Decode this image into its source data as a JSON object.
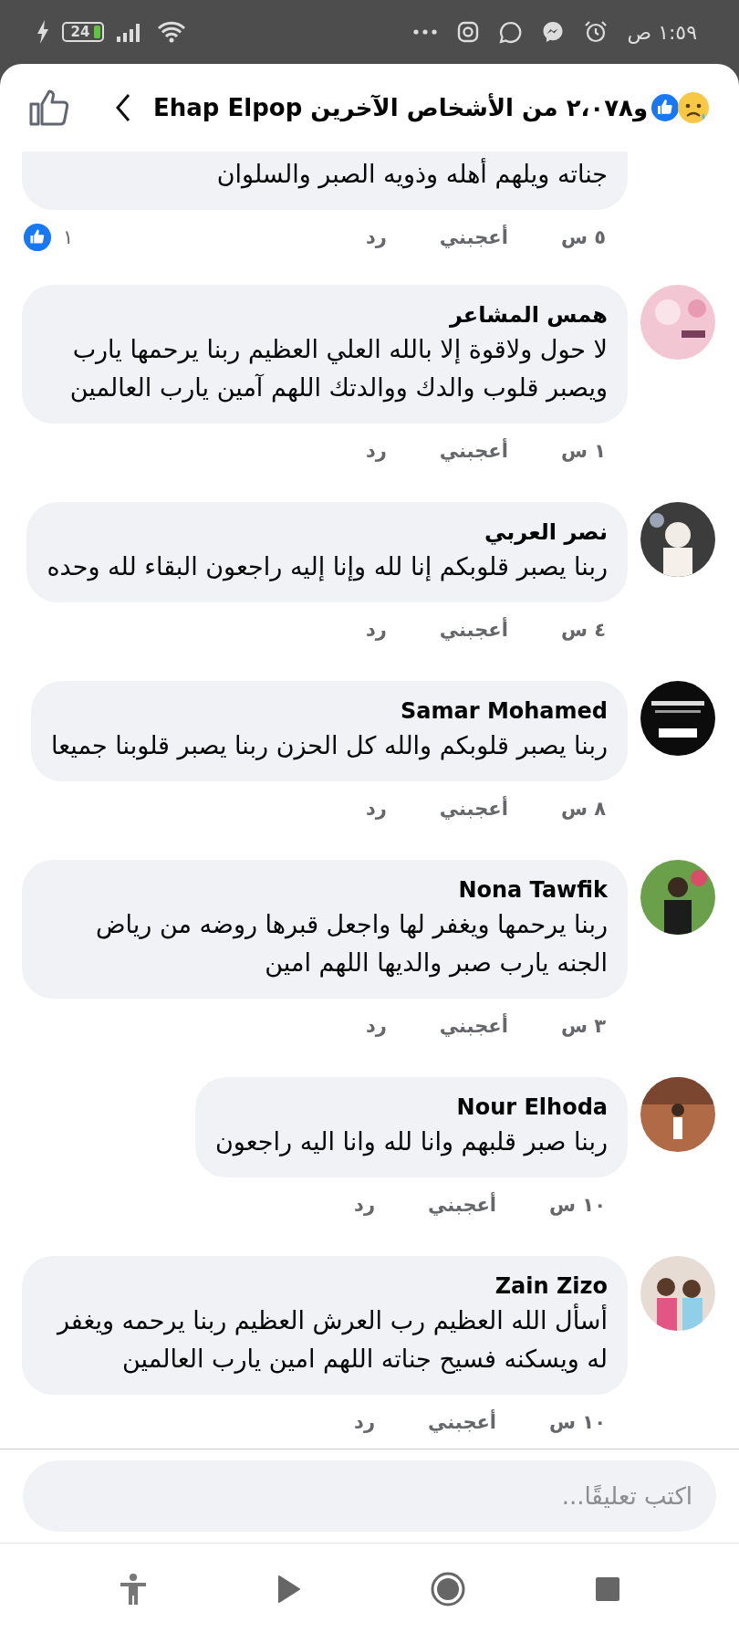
{
  "status_bar": {
    "time": "١:٥٩ ص",
    "battery": "24"
  },
  "header": {
    "title": "و٢،٠٧٨ من الأشخاص الآخرين Ehap Elpop"
  },
  "comments": [
    {
      "text": "جناته ويلهم أهله وذويه الصبر والسلوان",
      "time": "٥ س",
      "like": "أعجبني",
      "reply": "رد",
      "reactions": "١"
    },
    {
      "name": "همس المشاعر",
      "text": "لا حول ولاقوة إلا بالله العلي العظيم ربنا يرحمها يارب ويصبر قلوب والدك ووالدتك اللهم آمين يارب العالمين",
      "time": "١ س",
      "like": "أعجبني",
      "reply": "رد"
    },
    {
      "name": "نصر العربي",
      "text": "ربنا يصبر قلوبكم إنا لله وإنا إليه راجعون البقاء لله وحده",
      "time": "٤ س",
      "like": "أعجبني",
      "reply": "رد"
    },
    {
      "name": "Samar Mohamed",
      "text": "ربنا يصبر قلوبكم والله كل الحزن ربنا يصبر قلوبنا جميعا",
      "time": "٨ س",
      "like": "أعجبني",
      "reply": "رد"
    },
    {
      "name": "Nona Tawfik",
      "text": "ربنا يرحمها ويغفر لها واجعل قبرها روضه من رياض الجنه يارب صبر والديها اللهم امين",
      "time": "٣ س",
      "like": "أعجبني",
      "reply": "رد"
    },
    {
      "name": "Nour Elhoda",
      "text": "ربنا صبر قلبهم وانا لله وانا اليه راجعون",
      "time": "١٠ س",
      "like": "أعجبني",
      "reply": "رد"
    },
    {
      "name": "Zain Zizo",
      "text": "أسأل الله العظيم رب العرش العظيم ربنا يرحمه ويغفر له ويسكنه فسيح جناته اللهم امين يارب العالمين",
      "time": "١٠ س",
      "like": "أعجبني",
      "reply": "رد"
    }
  ],
  "composer": {
    "placeholder": "اكتب تعليقًا..."
  }
}
